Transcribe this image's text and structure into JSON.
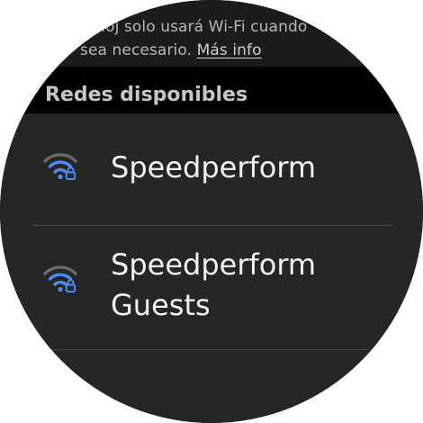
{
  "info": {
    "line1": "reloj solo usará Wi-Fi cuando",
    "line2_prefix": "sea necesario. ",
    "more_link": "Más info"
  },
  "section": {
    "title": "Redes disponibles"
  },
  "networks": [
    {
      "name_lines": [
        "Speedperform"
      ],
      "icon": "wifi-locked-icon",
      "signal_bars": 2
    },
    {
      "name_lines": [
        "Speedperform",
        "Guests"
      ],
      "icon": "wifi-locked-icon",
      "signal_bars": 2
    }
  ],
  "colors": {
    "icon_active": "#4a8cf0",
    "icon_inactive": "#6a6a6a",
    "card_bg": "#262626"
  }
}
